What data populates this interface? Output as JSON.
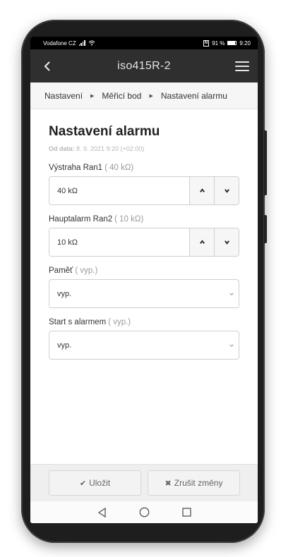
{
  "status_bar": {
    "carrier": "Vodafone CZ",
    "nfc": "N",
    "battery": "91 %",
    "time": "9:20"
  },
  "header": {
    "back_icon": "chevron-left-icon",
    "title": "iso415R-2",
    "menu_icon": "hamburger-menu-icon"
  },
  "breadcrumb": [
    {
      "label": "Nastavení"
    },
    {
      "label": "Měřicí bod"
    },
    {
      "label": "Nastavení alarmu"
    }
  ],
  "page": {
    "title": "Nastavení alarmu",
    "date_label": "Od data:",
    "date_value": "8. 9. 2021 9:20 (+02:00)"
  },
  "fields": {
    "ran1": {
      "label": "Výstraha Ran1",
      "hint": "( 40 kΩ)",
      "value": "40 kΩ"
    },
    "ran2": {
      "label": "Hauptalarm Ran2",
      "hint": "( 10 kΩ)",
      "value": "10 kΩ"
    },
    "pamet": {
      "label": "Paměť",
      "hint": "( vyp.)",
      "value": "vyp."
    },
    "start": {
      "label": "Start s alarmem",
      "hint": "( vyp.)",
      "value": "vyp."
    }
  },
  "footer": {
    "save_label": "Uložit",
    "save_icon": "check-icon",
    "cancel_label": "Zrušit změny",
    "cancel_icon": "x-icon"
  },
  "colors": {
    "appbar": "#2f2f2f",
    "breadcrumb_bg": "#f6f6f6",
    "footer_bg": "#efefef"
  }
}
